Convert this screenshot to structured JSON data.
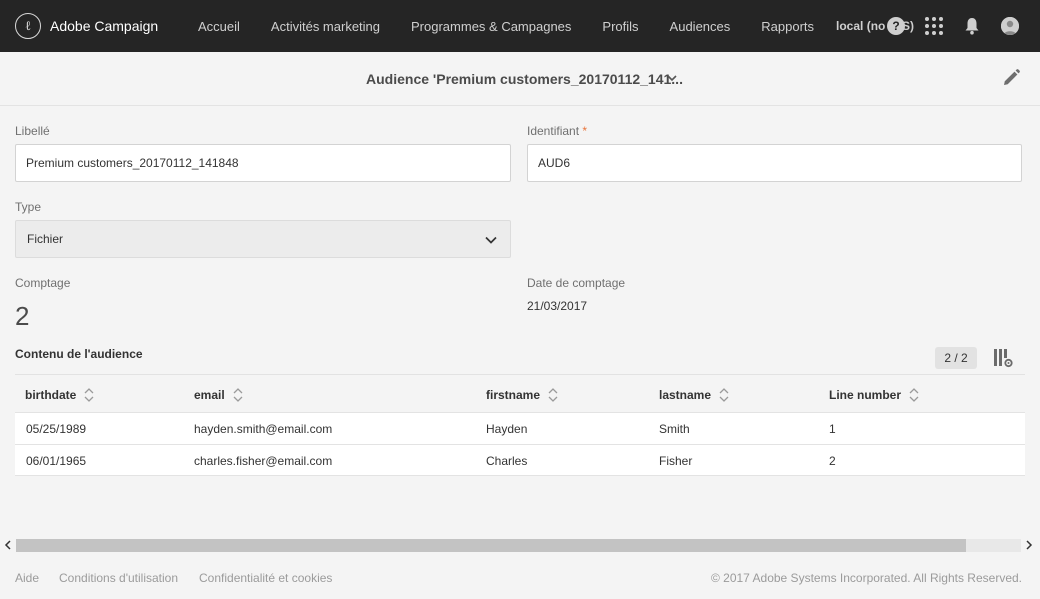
{
  "topbar": {
    "brand_logo_char": "ℓ",
    "brand_name": "Adobe Campaign",
    "nav": [
      "Accueil",
      "Activités marketing",
      "Programmes & Campagnes",
      "Profils",
      "Audiences",
      "Rapports"
    ],
    "user": "local (no IMS)",
    "help_char": "?"
  },
  "header": {
    "title": "Audience 'Premium customers_20170112_141..."
  },
  "form": {
    "label_label": "Libellé",
    "label_value": "Premium customers_20170112_141848",
    "identifier_label": "Identifiant",
    "identifier_required": "*",
    "identifier_value": "AUD6",
    "type_label": "Type",
    "type_value": "Fichier",
    "count_label": "Comptage",
    "count_value": "2",
    "count_date_label": "Date de comptage",
    "count_date_value": "21/03/2017"
  },
  "content": {
    "title": "Contenu de l'audience",
    "pager": "2 / 2",
    "columns": [
      "birthdate",
      "email",
      "firstname",
      "lastname",
      "Line number"
    ],
    "rows": [
      [
        "05/25/1989",
        "hayden.smith@email.com",
        "Hayden",
        "Smith",
        "1"
      ],
      [
        "06/01/1965",
        "charles.fisher@email.com",
        "Charles",
        "Fisher",
        "2"
      ]
    ]
  },
  "footer": {
    "links": [
      "Aide",
      "Conditions d'utilisation",
      "Confidentialité et cookies"
    ],
    "copyright": "© 2017 Adobe Systems Incorporated. All Rights Reserved."
  },
  "colors": {
    "topbar_bg": "#252525",
    "page_bg": "#f4f4f4",
    "required": "#e8743b"
  }
}
